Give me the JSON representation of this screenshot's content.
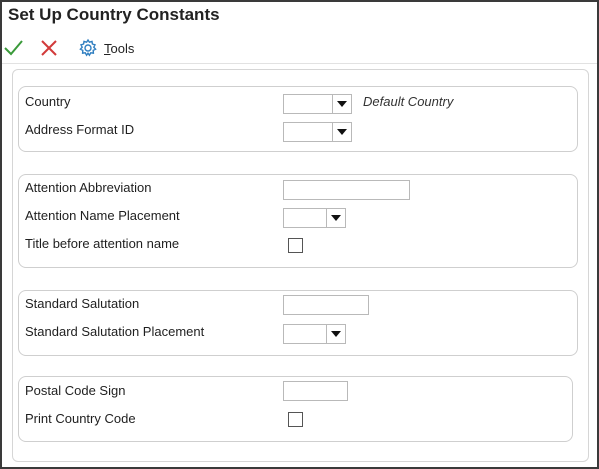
{
  "window": {
    "title": "Set Up Country Constants"
  },
  "toolbar": {
    "ok_icon": "checkmark-icon",
    "cancel_icon": "close-x-icon",
    "tools_icon": "gear-icon",
    "tools_label": "Tools",
    "ok_color": "#3a9a3a",
    "cancel_color": "#d23a3a",
    "tools_color": "#2f7ec0"
  },
  "group1": {
    "country_label": "Country",
    "country_value": "",
    "country_hint": "Default Country",
    "address_format_label": "Address Format ID",
    "address_format_value": ""
  },
  "group2": {
    "attention_abbrev_label": "Attention Abbreviation",
    "attention_abbrev_value": "",
    "attention_placement_label": "Attention Name Placement",
    "attention_placement_value": "",
    "title_before_label": "Title before attention name",
    "title_before_checked": false
  },
  "group3": {
    "salutation_label": "Standard Salutation",
    "salutation_value": "",
    "salutation_placement_label": "Standard Salutation Placement",
    "salutation_placement_value": ""
  },
  "group4": {
    "postal_sign_label": "Postal Code Sign",
    "postal_sign_value": "",
    "print_country_label": "Print Country Code",
    "print_country_checked": false
  }
}
